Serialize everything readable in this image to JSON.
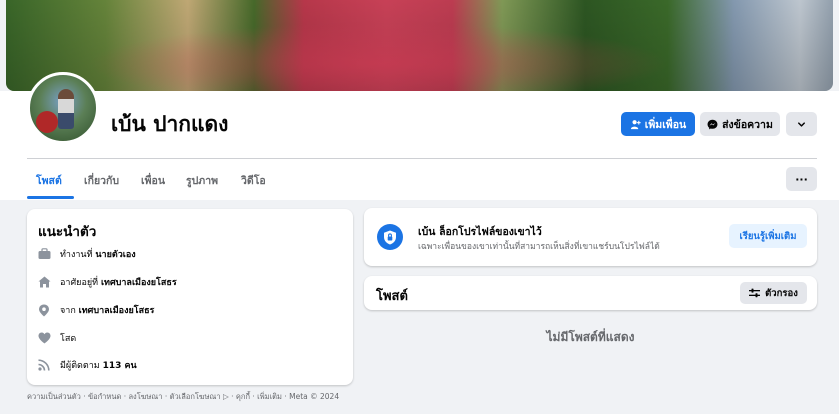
{
  "profile": {
    "name": "เบ้น ปากแดง",
    "actions": {
      "add_friend": "เพิ่มเพื่อน",
      "message": "ส่งข้อความ"
    }
  },
  "tabs": [
    {
      "label": "โพสต์"
    },
    {
      "label": "เกี่ยวกับ"
    },
    {
      "label": "เพื่อน"
    },
    {
      "label": "รูปภาพ"
    },
    {
      "label": "วิดีโอ"
    }
  ],
  "tab_more_label": "···",
  "intro": {
    "title": "แนะนำตัว",
    "work_prefix": "ทำงานที่",
    "work_value": "นายตัวเอง",
    "lives_prefix": "อาศัยอยู่ที่",
    "lives_value": "เทศบาลเมืองยโสธร",
    "from_prefix": "จาก",
    "from_value": "เทศบาลเมืองยโสธร",
    "relationship": "โสด",
    "followers_prefix": "มีผู้ติดตาม",
    "followers_value": "113 คน"
  },
  "footer": {
    "text": "ความเป็นส่วนตัว · ข้อกำหนด · ลงโฆษณา · ตัวเลือกโฆษณา ▷ · คุกกี้ · เพิ่มเติม · Meta © 2024"
  },
  "lock_notice": {
    "title": "เบ้น ล็อกโปรไฟล์ของเขาไว้",
    "subtitle": "เฉพาะเพื่อนของเขาเท่านั้นที่สามารถเห็นสิ่งที่เขาแชร์บนโปรไฟล์ได้",
    "learn_more": "เรียนรู้เพิ่มเติม"
  },
  "posts": {
    "title": "โพสต์",
    "filter": "ตัวกรอง",
    "empty": "ไม่มีโพสต์ที่แสดง"
  },
  "colors": {
    "accent": "#1b74e4",
    "background": "#f0f2f5",
    "secondary_button": "#e4e6eb"
  },
  "icons": {
    "work": "briefcase-icon",
    "lives": "home-icon",
    "from": "location-pin-icon",
    "relationship": "heart-icon",
    "followers": "rss-icon",
    "shield": "shield-icon",
    "filter": "sliders-icon"
  }
}
